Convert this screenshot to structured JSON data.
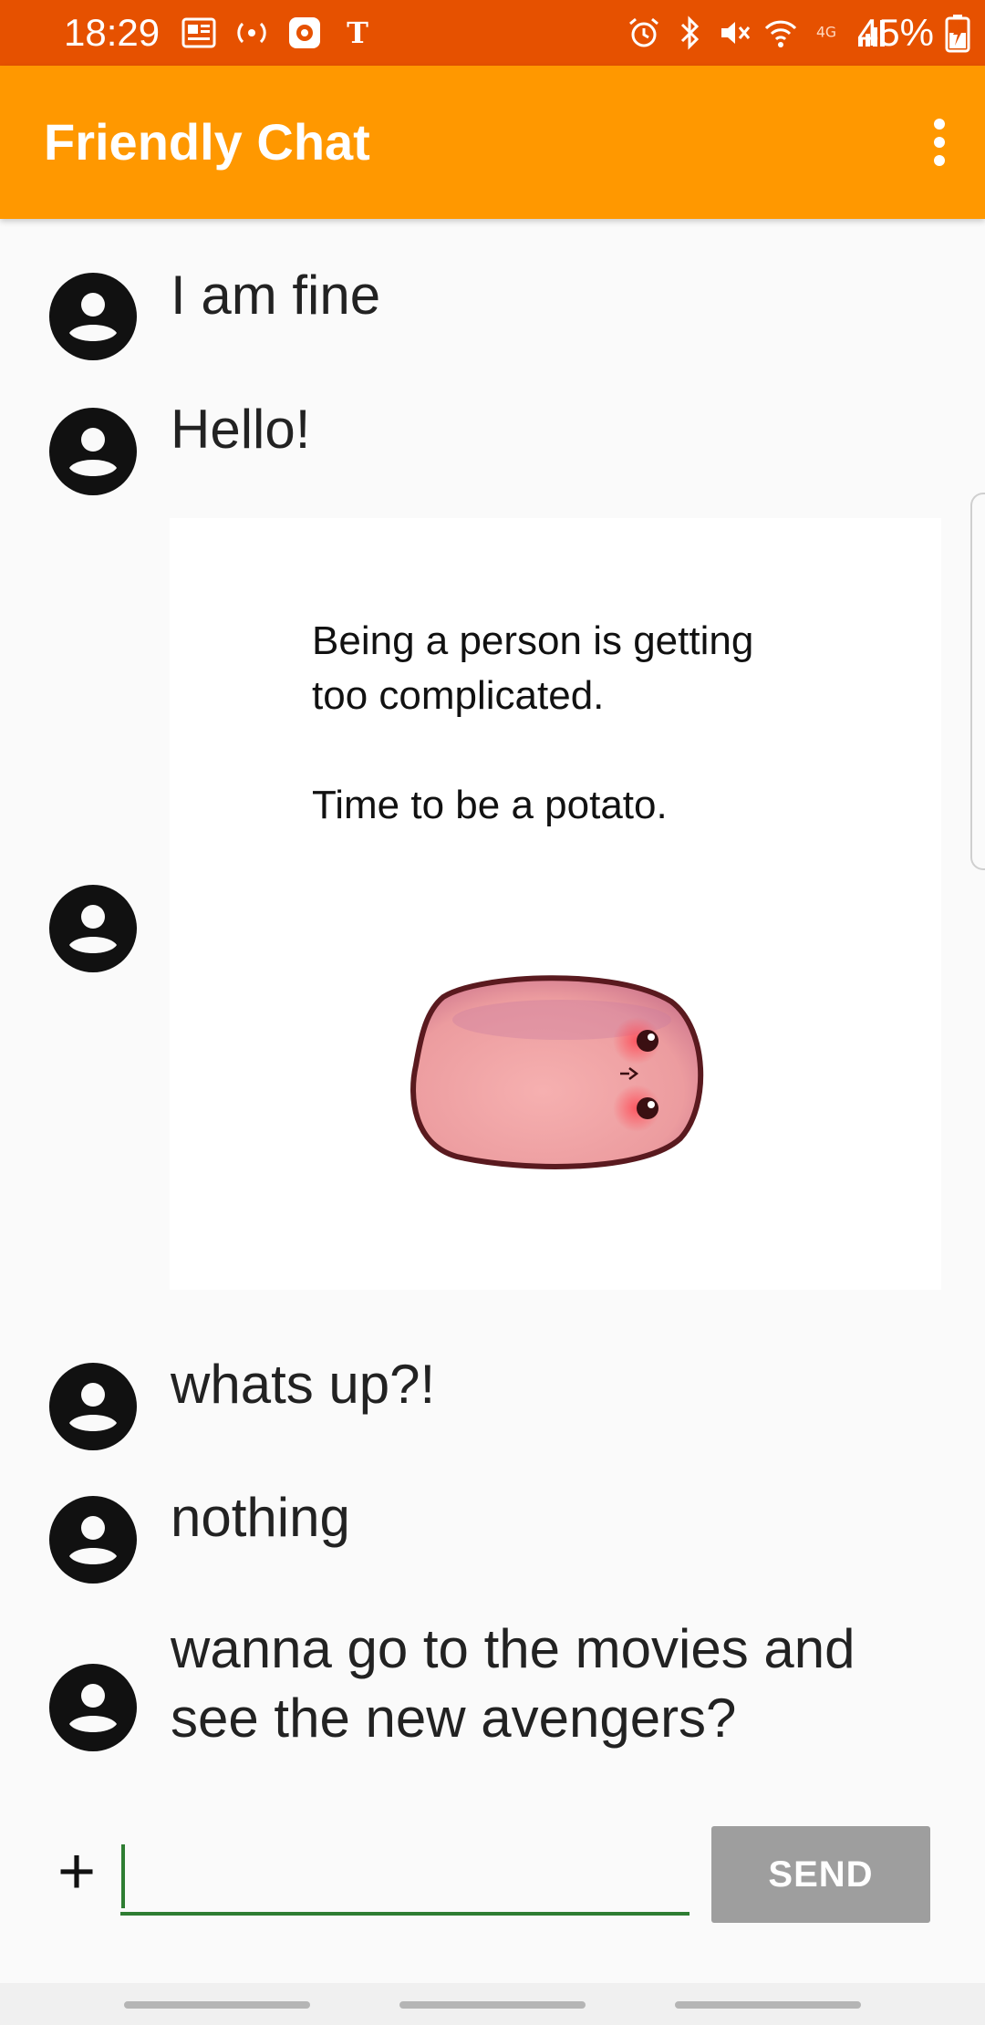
{
  "status_bar": {
    "time": "18:29",
    "battery": "45%",
    "icons": [
      "news-icon",
      "cast-icon",
      "app-icon",
      "nyt-icon",
      "alarm-icon",
      "bluetooth-icon",
      "mute-icon",
      "wifi-icon",
      "4g-icon",
      "signal-icon",
      "battery-icon"
    ]
  },
  "app_bar": {
    "title": "Friendly Chat",
    "menu_icon": "more-vert-icon"
  },
  "colors": {
    "status_bar": "#e65100",
    "app_bar": "#ff9800",
    "input_underline": "#2e7d32",
    "send_button": "#9e9e9e"
  },
  "messages": [
    {
      "type": "text",
      "text": "I am fine",
      "avatar": "account-circle-icon"
    },
    {
      "type": "text",
      "text": "Hello!",
      "avatar": "account-circle-icon"
    },
    {
      "type": "image",
      "avatar": "account-circle-icon",
      "image": {
        "text": "Being a person is getting\ntoo complicated.\n\nTime to be a potato.",
        "picture": "potato-illustration"
      }
    },
    {
      "type": "text",
      "text": "whats up?!",
      "avatar": "account-circle-icon"
    },
    {
      "type": "text",
      "text": "nothing",
      "avatar": "account-circle-icon"
    },
    {
      "type": "text",
      "text": "wanna go to the movies and see the new avengers?",
      "avatar": "account-circle-icon"
    }
  ],
  "composer": {
    "add_icon": "+",
    "input_value": "",
    "send_label": "SEND"
  }
}
